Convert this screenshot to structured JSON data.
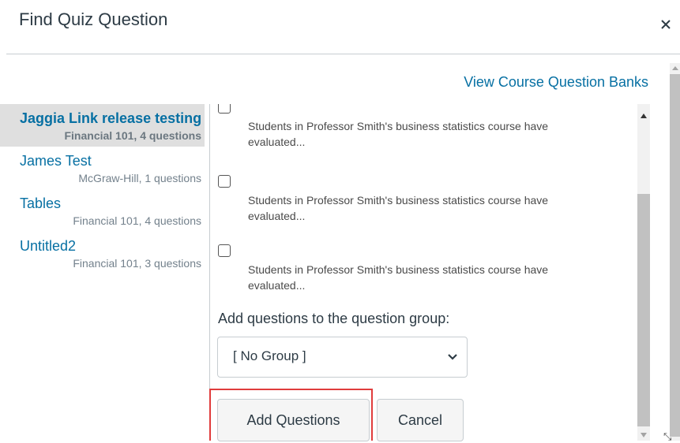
{
  "dialog": {
    "title": "Find Quiz Question",
    "close_label": "×",
    "view_banks_link": "View Course Question Banks"
  },
  "banks": [
    {
      "name": "Jaggia Link release testing",
      "meta": "Financial 101, 4 questions",
      "selected": true
    },
    {
      "name": "James Test",
      "meta": "McGraw-Hill, 1 questions",
      "selected": false
    },
    {
      "name": "Tables",
      "meta": "Financial 101, 4 questions",
      "selected": false
    },
    {
      "name": "Untitled2",
      "meta": "Financial 101, 3 questions",
      "selected": false
    }
  ],
  "questions": [
    {
      "text": "Students in Professor Smith's business statistics course have evaluated...",
      "checked": false
    },
    {
      "text": "Students in Professor Smith's business statistics course have evaluated...",
      "checked": false
    },
    {
      "text": "Students in Professor Smith's business statistics course have evaluated...",
      "checked": false
    }
  ],
  "group": {
    "label": "Add questions to the question group:",
    "selected": "[ No Group ]",
    "options": [
      "[ No Group ]"
    ]
  },
  "buttons": {
    "add": "Add Questions",
    "cancel": "Cancel"
  },
  "colors": {
    "link": "#0770a3",
    "highlight": "#e03c3c",
    "selected_bg": "#dfdfdf"
  }
}
